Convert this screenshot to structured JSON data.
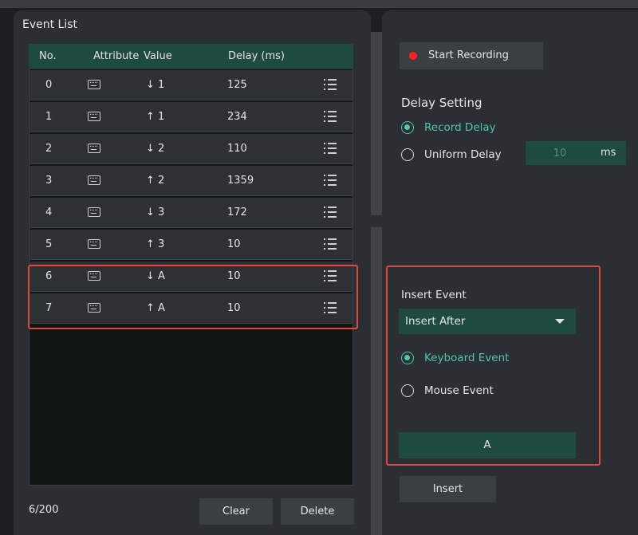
{
  "event_list": {
    "title": "Event List",
    "columns": {
      "no": "No.",
      "attribute": "Attribute",
      "value": "Value",
      "delay": "Delay (ms)"
    },
    "rows": [
      {
        "no": "0",
        "attribute_icon": "keyboard-icon",
        "value": "↓ 1",
        "delay": "125",
        "menu_icon": "list-icon"
      },
      {
        "no": "1",
        "attribute_icon": "keyboard-icon",
        "value": "↑ 1",
        "delay": "234",
        "menu_icon": "list-icon"
      },
      {
        "no": "2",
        "attribute_icon": "keyboard-icon",
        "value": "↓ 2",
        "delay": "110",
        "menu_icon": "list-icon"
      },
      {
        "no": "3",
        "attribute_icon": "keyboard-icon",
        "value": "↑ 2",
        "delay": "1359",
        "menu_icon": "list-icon"
      },
      {
        "no": "4",
        "attribute_icon": "keyboard-icon",
        "value": "↓ 3",
        "delay": "172",
        "menu_icon": "list-icon"
      },
      {
        "no": "5",
        "attribute_icon": "keyboard-icon",
        "value": "↑ 3",
        "delay": "10",
        "menu_icon": "list-icon"
      },
      {
        "no": "6",
        "attribute_icon": "keyboard-icon",
        "value": "↓ A",
        "delay": "10",
        "menu_icon": "list-icon"
      },
      {
        "no": "7",
        "attribute_icon": "keyboard-icon",
        "value": "↑ A",
        "delay": "10",
        "menu_icon": "list-icon"
      }
    ],
    "counter": "6/200",
    "clear_label": "Clear",
    "delete_label": "Delete"
  },
  "recording": {
    "start_label": "Start Recording",
    "dot_color": "#ff2020"
  },
  "delay_setting": {
    "title": "Delay Setting",
    "record_delay_label": "Record Delay",
    "uniform_delay_label": "Uniform Delay",
    "uniform_value": "10",
    "unit": "ms",
    "selected": "record_delay"
  },
  "insert_event": {
    "title": "Insert Event",
    "position_value": "Insert After",
    "keyboard_label": "Keyboard Event",
    "mouse_label": "Mouse Event",
    "selected": "keyboard",
    "key_value": "A",
    "insert_label": "Insert"
  },
  "colors": {
    "accent": "#4fc7ae",
    "header_green": "#1f4a3f",
    "highlight_red": "#e0473f",
    "panel_bg": "#2b2e33"
  }
}
